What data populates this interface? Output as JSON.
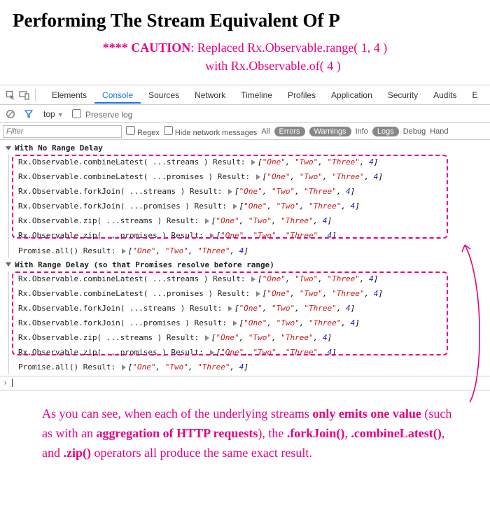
{
  "title": "Performing The Stream Equivalent Of P",
  "caution": {
    "prefix": "**** ",
    "label": "CAUTION",
    "line1_rest": ": Replaced Rx.Observable.range( 1, 4 )",
    "line2_prefix": "with ",
    "line2_rest": "Rx.Observable.of( 4 )"
  },
  "tabs": [
    "Elements",
    "Console",
    "Sources",
    "Network",
    "Timeline",
    "Profiles",
    "Application",
    "Security",
    "Audits",
    "E"
  ],
  "active_tab_index": 1,
  "subtool": {
    "context": "top",
    "preserve_label": "Preserve log"
  },
  "filterbar": {
    "filter_placeholder": "Filter",
    "regex_label": "Regex",
    "hide_label": "Hide network messages",
    "levels": {
      "all": "All",
      "errors": "Errors",
      "warnings": "Warnings",
      "info": "Info",
      "logs": "Logs",
      "debug": "Debug",
      "hand": "Hand"
    }
  },
  "groups": [
    {
      "header": "With No Range Delay"
    },
    {
      "header": "With Range Delay (so that Promises resolve before range)"
    }
  ],
  "result_values": [
    "\"One\"",
    "\"Two\"",
    "\"Three\"",
    "4"
  ],
  "log_methods": [
    "Rx.Observable.combineLatest( ...streams )",
    "Rx.Observable.combineLatest( ...promises )",
    "Rx.Observable.forkJoin( ...streams )",
    "Rx.Observable.forkJoin( ...promises )",
    "Rx.Observable.zip( ...streams )",
    "Rx.Observable.zip( ...promises )",
    "Promise.all()"
  ],
  "result_word": " Result: ",
  "explanation": {
    "t1": "As you can see, when each of the underlying streams ",
    "s1": "only emits one value",
    "t2": " (such as with an ",
    "s2": "aggregation of HTTP requests",
    "t3": "), the ",
    "s3": ".forkJoin()",
    "t4": ", ",
    "s4": ".combineLatest()",
    "t5": ", and ",
    "s5": ".zip()",
    "t6": " operators all produce the same exact result."
  }
}
